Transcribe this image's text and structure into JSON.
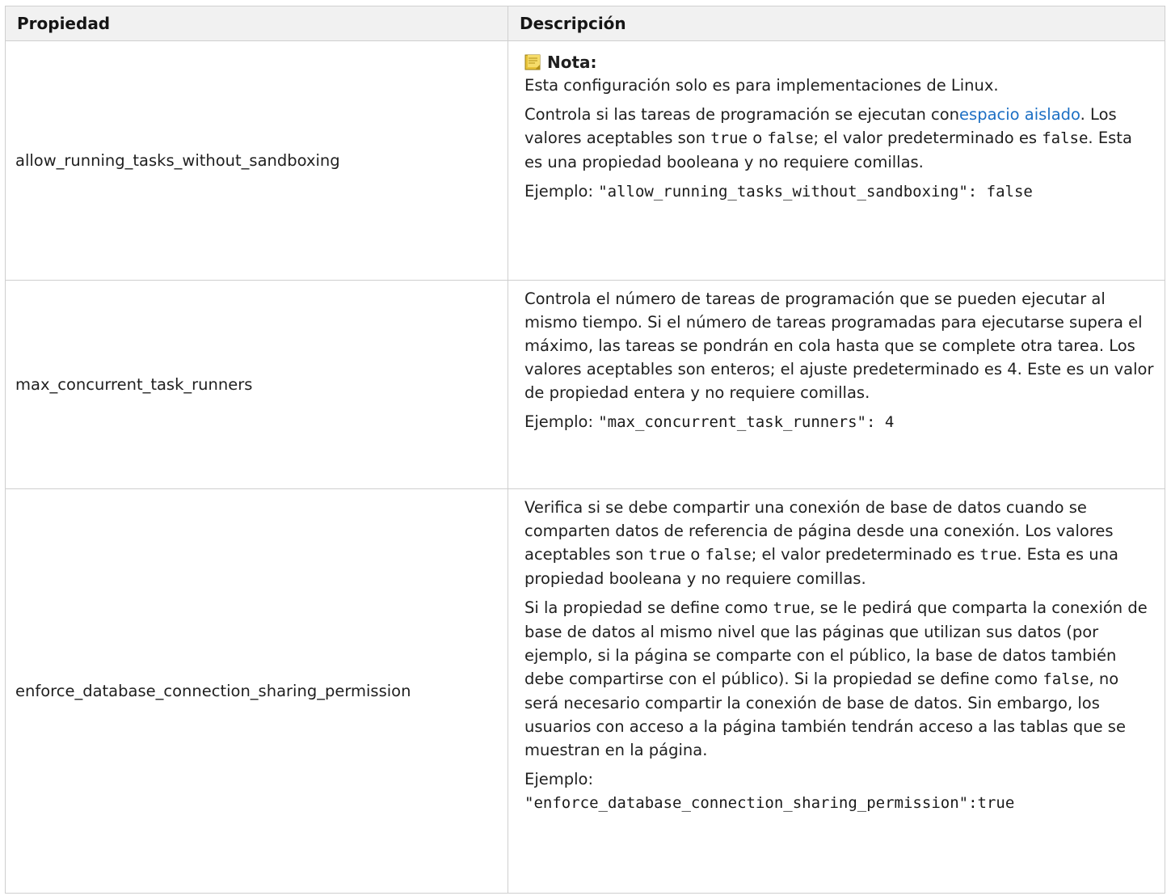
{
  "header": {
    "col1": "Propiedad",
    "col2": "Descripción"
  },
  "rows": [
    {
      "property": "allow_running_tasks_without_sandboxing",
      "note_title": "Nota:",
      "note_text": "Esta configuración solo es para implementaciones de Linux.",
      "p1_a": "Controla si las tareas de programación se ejecutan con",
      "link": "espacio aislado",
      "p1_b": ". Los valores aceptables son ",
      "code_true": "true",
      "p1_c": " o ",
      "code_false": "false",
      "p1_d": "; el valor predeterminado es ",
      "code_default": "false",
      "p1_e": ". Esta es una propiedad booleana y no requiere comillas.",
      "example_label": "Ejemplo: ",
      "example_code": "\"allow_running_tasks_without_sandboxing\": false"
    },
    {
      "property": "max_concurrent_task_runners",
      "p1": "Controla el número de tareas de programación que se pueden ejecutar al mismo tiempo. Si el número de tareas programadas para ejecutarse supera el máximo, las tareas se pondrán en cola hasta que se complete otra tarea. Los valores aceptables son enteros; el ajuste predeterminado es 4. Este es un valor de propiedad entera y no requiere comillas.",
      "example_label": "Ejemplo: ",
      "example_code": "\"max_concurrent_task_runners\": 4"
    },
    {
      "property": "enforce_database_connection_sharing_permission",
      "p1_a": "Verifica si se debe compartir una conexión de base de datos cuando se comparten datos de referencia de página desde una conexión. Los valores aceptables son ",
      "code_true": "true",
      "p1_b": " o ",
      "code_false": "false",
      "p1_c": "; el valor predeterminado es ",
      "code_default": "true",
      "p1_d": ". Esta es una propiedad booleana y no requiere comillas.",
      "p2_a": "Si la propiedad se define como ",
      "p2_code_true": "true",
      "p2_b": ", se le pedirá que comparta la conexión de base de datos al mismo nivel que las páginas que utilizan sus datos (por ejemplo, si la página se comparte con el público, la base de datos también debe compartirse con el público). Si la propiedad se define como ",
      "p2_code_false": "false",
      "p2_c": ", no será necesario compartir la conexión de base de datos. Sin embargo, los usuarios con acceso a la página también tendrán acceso a las tablas que se muestran en la página.",
      "example_label": "Ejemplo: ",
      "example_code": "\"enforce_database_connection_sharing_permission\":true"
    }
  ],
  "note_icon": "note-icon",
  "colors": {
    "link": "#1c6fc4",
    "header_bg": "#f1f1f1",
    "border": "#cfcfcf",
    "note_icon": "#e8c33a"
  }
}
